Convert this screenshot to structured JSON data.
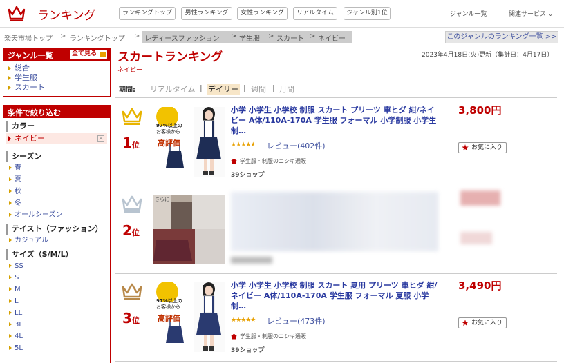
{
  "header": {
    "logo_text": "ランキング",
    "nav": [
      "ランキングトップ",
      "男性ランキング",
      "女性ランキング",
      "リアルタイム",
      "ジャンル別1位"
    ],
    "genre_list": "ジャンル一覧",
    "related": "関連サービス"
  },
  "breadcrumb": {
    "items": [
      "楽天市場トップ",
      "ランキングトップ",
      "レディースファッション",
      "学生服",
      "スカート",
      "ネイビー"
    ],
    "genre_ranking_link": "このジャンルのランキング一覧 >>"
  },
  "sidebar": {
    "genre_title": "ジャンル一覧",
    "see_all": "全て見る",
    "genres": [
      "総合",
      "学生服",
      "スカート"
    ],
    "filter_title": "条件で絞り込む",
    "color": {
      "heading": "カラー",
      "selected": "ネイビー"
    },
    "season": {
      "heading": "シーズン",
      "items": [
        "春",
        "夏",
        "秋",
        "冬",
        "オールシーズン"
      ]
    },
    "taste": {
      "heading": "テイスト（ファッション）",
      "items": [
        "カジュアル"
      ]
    },
    "size": {
      "heading": "サイズ（S/M/L）",
      "items": [
        "SS",
        "S",
        "M",
        "L",
        "LL",
        "3L",
        "4L",
        "5L"
      ],
      "selected": "L"
    }
  },
  "main": {
    "title": "スカートランキング",
    "subtitle": "ネイビー",
    "update": "2023年4月18日(火)更新（集計日：4月17日）",
    "period_label": "期間:",
    "periods": [
      "リアルタイム",
      "デイリー",
      "週間",
      "月間"
    ],
    "active_period": "デイリー"
  },
  "items": [
    {
      "rank": "1",
      "rank_suffix": "位",
      "title": "小学 小学生 小学校 制服 スカート プリーツ 車ヒダ 紺/ネイビー A体/110A-170A 学生服 フォーマル 小学制服 小学生制…",
      "price": "3,800円",
      "stars": "★★★★★",
      "review": "レビュー(402件)",
      "shop": "学生服・制服のニシキ通販",
      "shipping": "39ショップ",
      "fav": "お気に入り",
      "thumb_badge": "97%以上の",
      "thumb_badge2": "お客様から",
      "thumb_rating": "高評価",
      "crown_color": "#e8b400"
    },
    {
      "rank": "2",
      "rank_suffix": "位",
      "thumb_label": "さらに",
      "crown_color": "#b8c4d0"
    },
    {
      "rank": "3",
      "rank_suffix": "位",
      "title": "小学 小学生 小学校 制服 スカート 夏用 プリーツ 車ヒダ 紺/ネイビー A体/110A-170A 学生服 フォーマル 夏服 小学制…",
      "price": "3,490円",
      "stars": "★★★★★",
      "review": "レビュー(473件)",
      "shop": "学生服・制服のニシキ通販",
      "shipping": "39ショップ",
      "fav": "お気に入り",
      "thumb_badge": "97%以上の",
      "thumb_badge2": "お客様から",
      "thumb_rating": "高評価",
      "crown_color": "#b8894a"
    }
  ],
  "colors": {
    "brand_red": "#bf0000",
    "link_blue": "#3d4f9e",
    "gold": "#e8b400",
    "silver": "#b8c4d0",
    "bronze": "#b8894a"
  }
}
